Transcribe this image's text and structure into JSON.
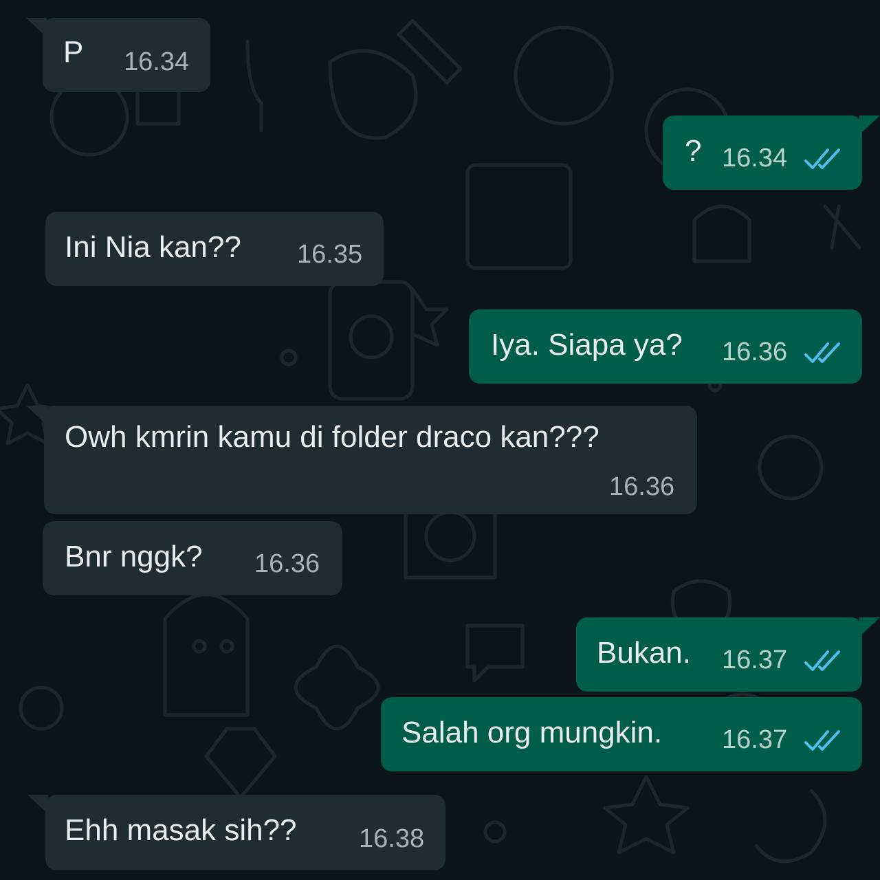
{
  "colors": {
    "background": "#0b141a",
    "incoming_bubble": "#1f2c34",
    "outgoing_bubble": "#005c4b",
    "read_ticks": "#53bdeb",
    "text": "#e9edef"
  },
  "messages": [
    {
      "direction": "incoming",
      "text": "P",
      "time": "16.34"
    },
    {
      "direction": "outgoing",
      "text": "?",
      "time": "16.34",
      "status": "read-ticks-icon"
    },
    {
      "direction": "incoming",
      "text": "Ini Nia kan??",
      "time": "16.35"
    },
    {
      "direction": "outgoing",
      "text": "Iya. Siapa ya?",
      "time": "16.36",
      "status": "read-ticks-icon"
    },
    {
      "direction": "incoming",
      "text": "Owh kmrin kamu di folder draco kan???",
      "time": "16.36"
    },
    {
      "direction": "incoming",
      "text": "Bnr nggk?",
      "time": "16.36"
    },
    {
      "direction": "outgoing",
      "text": "Bukan.",
      "time": "16.37",
      "status": "read-ticks-icon"
    },
    {
      "direction": "outgoing",
      "text": "Salah org mungkin.",
      "time": "16.37",
      "status": "read-ticks-icon"
    },
    {
      "direction": "incoming",
      "text": "Ehh masak sih??",
      "time": "16.38"
    }
  ]
}
